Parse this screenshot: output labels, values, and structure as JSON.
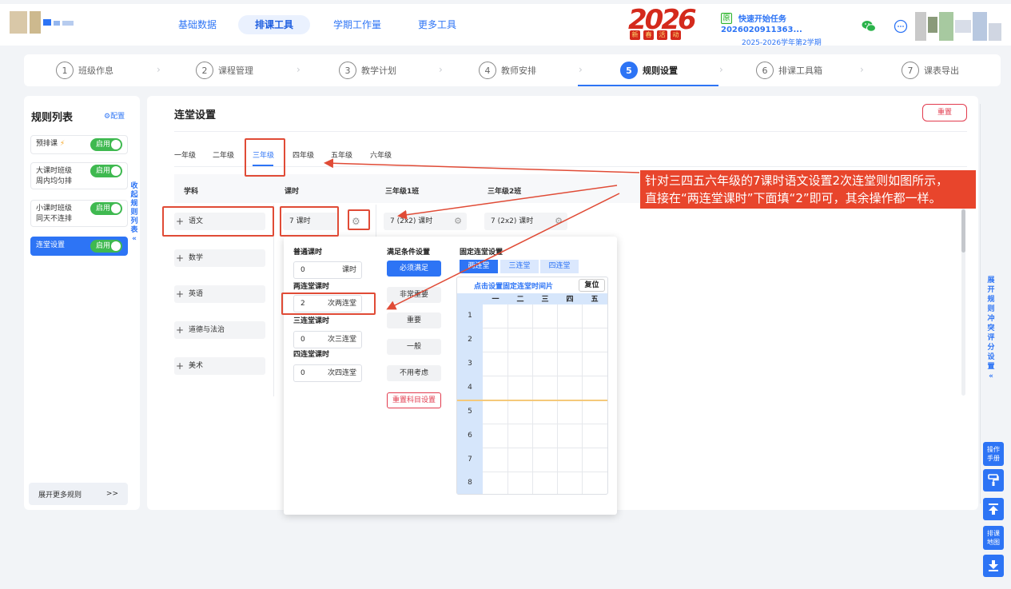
{
  "header": {
    "nav": [
      "基础数据",
      "排课工具",
      "学期工作量",
      "更多工具"
    ],
    "banner_text": "2026",
    "banner_sub": [
      "新",
      "春",
      "活",
      "动"
    ],
    "task_tag": "原",
    "task_title": "快速开始任务2026020911363...",
    "task_term": "2025-2026学年第2学期"
  },
  "steps": [
    {
      "num": "1",
      "label": "班级作息"
    },
    {
      "num": "2",
      "label": "课程管理"
    },
    {
      "num": "3",
      "label": "教学计划"
    },
    {
      "num": "4",
      "label": "教师安排"
    },
    {
      "num": "5",
      "label": "规则设置"
    },
    {
      "num": "6",
      "label": "排课工具箱"
    },
    {
      "num": "7",
      "label": "课表导出"
    }
  ],
  "left": {
    "title": "规则列表",
    "config": "⚙配置",
    "rules": [
      {
        "line1": "预排课",
        "line2": "",
        "toggle": "启用"
      },
      {
        "line1": "大课时班级",
        "line2": "周内均匀排",
        "toggle": "启用"
      },
      {
        "line1": "小课时班级",
        "line2": "同天不连排",
        "toggle": "启用"
      },
      {
        "line1": "连堂设置",
        "line2": "",
        "toggle": "启用"
      }
    ],
    "collapse": [
      "收",
      "起",
      "规",
      "则",
      "列",
      "表",
      "«"
    ],
    "more": "展开更多规则",
    "more_arrow": ">>"
  },
  "main": {
    "title": "连堂设置",
    "reset": "重置",
    "grades": [
      "一年级",
      "二年级",
      "三年级",
      "四年级",
      "五年级",
      "六年级"
    ],
    "headers": [
      "学科",
      "课时",
      "三年级1班",
      "三年级2班"
    ],
    "subjects": [
      "语文",
      "数学",
      "英语",
      "道德与法治",
      "美术"
    ],
    "hours": "7 课时",
    "class1": "7 (2x2) 课时",
    "class2": "7 (2x2) 课时"
  },
  "popup": {
    "normal_label": "普通课时",
    "normal_value": "0",
    "normal_unit": "课时",
    "two_label": "两连堂课时",
    "two_value": "2",
    "two_unit": "次两连堂",
    "three_label": "三连堂课时",
    "three_value": "0",
    "three_unit": "次三连堂",
    "four_label": "四连堂课时",
    "four_value": "0",
    "four_unit": "次四连堂",
    "cond_label": "满足条件设置",
    "prios": [
      "必须满足",
      "非常重要",
      "重要",
      "一般",
      "不用考虑"
    ],
    "reset_subject": "重置科目设置",
    "fixed_label": "固定连堂设置",
    "fixed_tabs": [
      "两连堂",
      "三连堂",
      "四连堂"
    ],
    "grid_title": "点击设置固定连堂时间片",
    "grid_reset": "复位",
    "days": [
      "一",
      "二",
      "三",
      "四",
      "五"
    ],
    "periods": [
      "1",
      "2",
      "3",
      "4",
      "5",
      "6",
      "7",
      "8"
    ]
  },
  "annotation": {
    "line1": "针对三四五六年级的7课时语文设置2次连堂则如图所示，",
    "line2": "直接在“两连堂课时”下面填“2”即可，其余操作都一样。"
  },
  "right": {
    "collapse": [
      "展",
      "开",
      "规",
      "则",
      "冲",
      "突",
      "评",
      "分",
      "设",
      "置",
      "«"
    ],
    "manual": [
      "操作",
      "手册"
    ],
    "map": [
      "排课",
      "地图"
    ]
  }
}
